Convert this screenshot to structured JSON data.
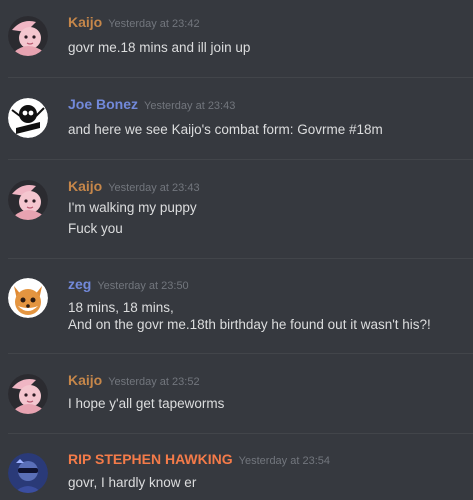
{
  "colors": {
    "background": "#36393f",
    "divider": "#42454a",
    "timestamp": "#72767d",
    "text": "#dcddde"
  },
  "messages": [
    {
      "username": "Kaijo",
      "name_color": "#c6874a",
      "timestamp": "Yesterday at 23:42",
      "avatar_icon": "pink-character-avatar-icon",
      "lines": [
        "govr me.18 mins and ill join up"
      ]
    },
    {
      "username": "Joe Bonez",
      "name_color": "#7289da",
      "timestamp": "Yesterday at 23:43",
      "avatar_icon": "skeleton-character-avatar-icon",
      "lines": [
        "and here we see Kaijo's combat form: Govrme #18m"
      ]
    },
    {
      "username": "Kaijo",
      "name_color": "#c6874a",
      "timestamp": "Yesterday at 23:43",
      "avatar_icon": "pink-character-avatar-icon",
      "lines": [
        "I'm walking my puppy",
        "Fuck you"
      ]
    },
    {
      "username": "zeg",
      "name_color": "#7289da",
      "timestamp": "Yesterday at 23:50",
      "avatar_icon": "fox-avatar-icon",
      "lines": [
        "18 mins, 18 mins,",
        "And on the govr me.18th birthday he found out it wasn't his?!"
      ]
    },
    {
      "username": "Kaijo",
      "name_color": "#c6874a",
      "timestamp": "Yesterday at 23:52",
      "avatar_icon": "pink-character-avatar-icon",
      "lines": [
        "I hope y'all get  tapeworms"
      ]
    },
    {
      "username": "RIP STEPHEN HAWKING",
      "name_color": "#f47b49",
      "timestamp": "Yesterday at 23:54",
      "avatar_icon": "sunglasses-person-avatar-icon",
      "lines": [
        "govr, I hardly know er"
      ]
    }
  ]
}
